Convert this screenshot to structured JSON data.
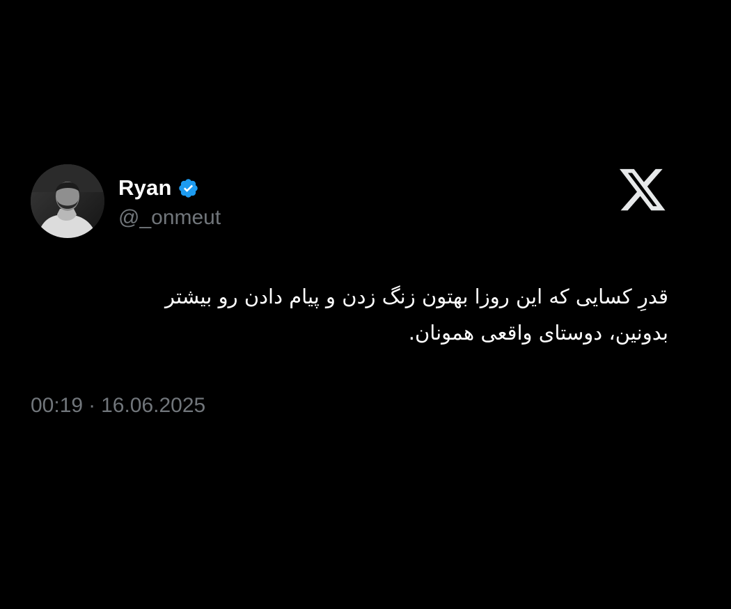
{
  "user": {
    "display_name": "Ryan",
    "handle": "@_onmeut",
    "verified": true,
    "verified_color": "#1d9bf0"
  },
  "brand": {
    "logo": "x-logo-icon"
  },
  "tweet": {
    "lines": [
      "قدرِ کسایی که این روزا بهتون زنگ زدن و پیام دادن رو بیشتر",
      "بدونین، دوستای واقعی همونان."
    ],
    "time": "00:19",
    "separator": "·",
    "date": "16.06.2025"
  },
  "colors": {
    "background": "#000000",
    "text": "#ffffff",
    "muted": "#71767b"
  }
}
